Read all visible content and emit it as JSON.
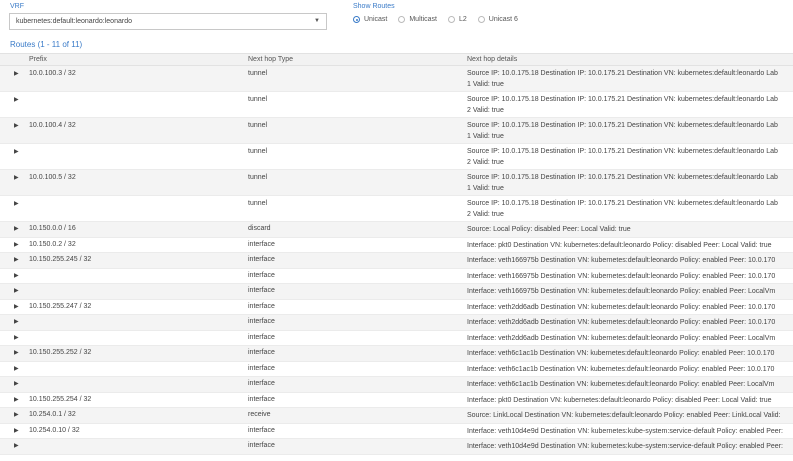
{
  "vrf": {
    "label": "VRF",
    "selected": "kubernetes:default:leonardo:leonardo"
  },
  "show_routes": {
    "label": "Show Routes",
    "options": [
      "Unicast",
      "Multicast",
      "L2",
      "Unicast 6"
    ],
    "selected": "Unicast"
  },
  "routes_title": "Routes (1 - 11 of 11)",
  "columns": [
    "Prefix",
    "Next hop Type",
    "Next hop details"
  ],
  "rows": [
    {
      "prefix": "10.0.100.3 / 32",
      "type": "tunnel",
      "details": [
        "Source IP: 10.0.175.18   Destination IP: 10.0.175.21   Destination VN: kubernetes:default:leonardo   Lab",
        "1   Valid: true"
      ]
    },
    {
      "prefix": "",
      "type": "tunnel",
      "details": [
        "Source IP: 10.0.175.18   Destination IP: 10.0.175.21   Destination VN: kubernetes:default:leonardo   Lab",
        "2   Valid: true"
      ]
    },
    {
      "prefix": "10.0.100.4 / 32",
      "type": "tunnel",
      "details": [
        "Source IP: 10.0.175.18   Destination IP: 10.0.175.21   Destination VN: kubernetes:default:leonardo   Lab",
        "1   Valid: true"
      ]
    },
    {
      "prefix": "",
      "type": "tunnel",
      "details": [
        "Source IP: 10.0.175.18   Destination IP: 10.0.175.21   Destination VN: kubernetes:default:leonardo   Lab",
        "2   Valid: true"
      ]
    },
    {
      "prefix": "10.0.100.5 / 32",
      "type": "tunnel",
      "details": [
        "Source IP: 10.0.175.18   Destination IP: 10.0.175.21   Destination VN: kubernetes:default:leonardo   Lab",
        "1   Valid: true"
      ]
    },
    {
      "prefix": "",
      "type": "tunnel",
      "details": [
        "Source IP: 10.0.175.18   Destination IP: 10.0.175.21   Destination VN: kubernetes:default:leonardo   Lab",
        "2   Valid: true"
      ]
    },
    {
      "prefix": "10.150.0.0 / 16",
      "type": "discard",
      "details": [
        "Source: Local   Policy: disabled   Peer: Local   Valid: true"
      ]
    },
    {
      "prefix": "10.150.0.2 / 32",
      "type": "interface",
      "details": [
        "Interface: pkt0   Destination VN: kubernetes:default:leonardo   Policy: disabled   Peer: Local   Valid: true"
      ]
    },
    {
      "prefix": "10.150.255.245 / 32",
      "type": "interface",
      "details": [
        "Interface: veth166975b   Destination VN: kubernetes:default:leonardo   Policy: enabled   Peer: 10.0.170"
      ]
    },
    {
      "prefix": "",
      "type": "interface",
      "details": [
        "Interface: veth166975b   Destination VN: kubernetes:default:leonardo   Policy: enabled   Peer: 10.0.170"
      ]
    },
    {
      "prefix": "",
      "type": "interface",
      "details": [
        "Interface: veth166975b   Destination VN: kubernetes:default:leonardo   Policy: enabled   Peer: LocalVm"
      ]
    },
    {
      "prefix": "10.150.255.247 / 32",
      "type": "interface",
      "details": [
        "Interface: veth2dd6adb   Destination VN: kubernetes:default:leonardo   Policy: enabled   Peer: 10.0.170"
      ]
    },
    {
      "prefix": "",
      "type": "interface",
      "details": [
        "Interface: veth2dd6adb   Destination VN: kubernetes:default:leonardo   Policy: enabled   Peer: 10.0.170"
      ]
    },
    {
      "prefix": "",
      "type": "interface",
      "details": [
        "Interface: veth2dd6adb   Destination VN: kubernetes:default:leonardo   Policy: enabled   Peer: LocalVm"
      ]
    },
    {
      "prefix": "10.150.255.252 / 32",
      "type": "interface",
      "details": [
        "Interface: veth6c1ac1b   Destination VN: kubernetes:default:leonardo   Policy: enabled   Peer: 10.0.170"
      ]
    },
    {
      "prefix": "",
      "type": "interface",
      "details": [
        "Interface: veth6c1ac1b   Destination VN: kubernetes:default:leonardo   Policy: enabled   Peer: 10.0.170"
      ]
    },
    {
      "prefix": "",
      "type": "interface",
      "details": [
        "Interface: veth6c1ac1b   Destination VN: kubernetes:default:leonardo   Policy: enabled   Peer: LocalVm"
      ]
    },
    {
      "prefix": "10.150.255.254 / 32",
      "type": "interface",
      "details": [
        "Interface: pkt0   Destination VN: kubernetes:default:leonardo   Policy: disabled   Peer: Local   Valid: true"
      ]
    },
    {
      "prefix": "10.254.0.1 / 32",
      "type": "receive",
      "details": [
        "Source: LinkLocal   Destination VN: kubernetes:default:leonardo   Policy: enabled   Peer: LinkLocal   Valid:"
      ]
    },
    {
      "prefix": "10.254.0.10 / 32",
      "type": "interface",
      "details": [
        "Interface: veth10d4e9d   Destination VN: kubernetes:kube-system:service-default   Policy: enabled   Peer:"
      ]
    },
    {
      "prefix": "",
      "type": "interface",
      "details": [
        "Interface: veth10d4e9d   Destination VN: kubernetes:kube-system:service-default   Policy: enabled   Peer:"
      ]
    }
  ]
}
